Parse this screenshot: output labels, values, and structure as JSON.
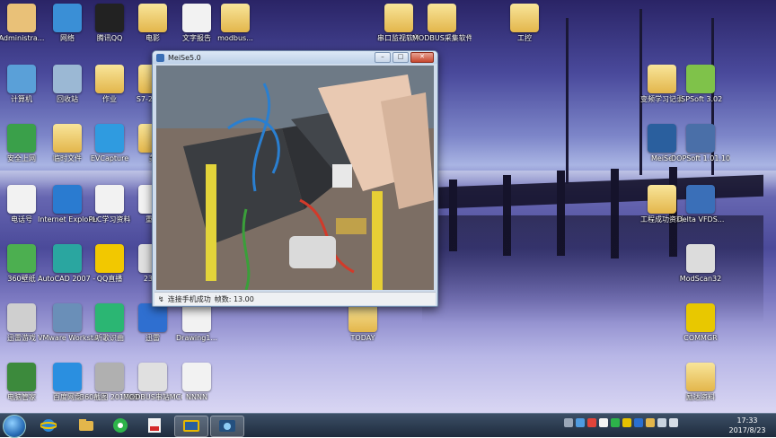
{
  "desktop": {
    "icons": [
      {
        "label": "Administra...",
        "kind": "user",
        "color": "#e9c178"
      },
      {
        "label": "网络",
        "kind": "globe",
        "color": "#3a8fd6"
      },
      {
        "label": "腾讯QQ",
        "kind": "qq",
        "color": "#222222"
      },
      {
        "label": "电影",
        "kind": "folder",
        "color": "#e6c15a"
      },
      {
        "label": "文字报告",
        "kind": "doc",
        "color": "#f2f2f2"
      },
      {
        "label": "modbus...",
        "kind": "folder",
        "color": "#e6c15a"
      },
      {
        "label": "串口监视软件",
        "kind": "folder",
        "color": "#e6c15a"
      },
      {
        "label": "MODBUS采集软件",
        "kind": "folder",
        "color": "#e6c15a"
      },
      {
        "label": "工控",
        "kind": "folder",
        "color": "#e6c15a"
      },
      {
        "label": "计算机",
        "kind": "computer",
        "color": "#5aa0d8"
      },
      {
        "label": "回收站",
        "kind": "bin",
        "color": "#9bb8d4"
      },
      {
        "label": "作业",
        "kind": "folder",
        "color": "#e6c15a"
      },
      {
        "label": "S7-200软",
        "kind": "folder",
        "color": "#e6c15a"
      },
      {
        "label": "安全上网",
        "kind": "ie",
        "color": "#3aa04a"
      },
      {
        "label": "临时文件",
        "kind": "folder",
        "color": "#e6c15a"
      },
      {
        "label": "EVCapture",
        "kind": "ev",
        "color": "#2f9be0"
      },
      {
        "label": "美",
        "kind": "folder",
        "color": "#e6c15a"
      },
      {
        "label": "电话号",
        "kind": "doc",
        "color": "#f2f2f2"
      },
      {
        "label": "Internet Explorer",
        "kind": "ie",
        "color": "#2a7bd0"
      },
      {
        "label": "PLC学习资料",
        "kind": "doc",
        "color": "#f2f2f2"
      },
      {
        "label": "重庆",
        "kind": "doc",
        "color": "#f2f2f2"
      },
      {
        "label": "360壁纸",
        "kind": "app",
        "color": "#4caf50"
      },
      {
        "label": "AutoCAD 2007 - S...",
        "kind": "app",
        "color": "#2aa6a0"
      },
      {
        "label": "QQ直播",
        "kind": "app",
        "color": "#f2c800"
      },
      {
        "label": "2345",
        "kind": "app",
        "color": "#e0e0e0"
      },
      {
        "label": "迅雷游戏",
        "kind": "app",
        "color": "#cfcfcf"
      },
      {
        "label": "VMware Workstation",
        "kind": "app",
        "color": "#6a8fb8"
      },
      {
        "label": "听歌识曲",
        "kind": "app",
        "color": "#2bb673"
      },
      {
        "label": "迅雷",
        "kind": "app",
        "color": "#2f6fd0"
      },
      {
        "label": "Drawing1...",
        "kind": "doc",
        "color": "#f2f2f2"
      },
      {
        "label": "TODAY",
        "kind": "folder",
        "color": "#e6c15a"
      },
      {
        "label": "电脑管家",
        "kind": "app",
        "color": "#3c8a3c"
      },
      {
        "label": "百度网盘",
        "kind": "app",
        "color": "#2a8fe0"
      },
      {
        "label": "360截图 20170804...",
        "kind": "img",
        "color": "#b0b0b0"
      },
      {
        "label": "MODBUS串站MCGS",
        "kind": "app",
        "color": "#e0e0e0"
      },
      {
        "label": "NNNN",
        "kind": "doc",
        "color": "#f2f2f2"
      },
      {
        "label": "变频学习记录",
        "kind": "folder",
        "color": "#e6c15a"
      },
      {
        "label": "ISPSoft 3.02",
        "kind": "app",
        "color": "#7fc24a"
      },
      {
        "label": "MeiSe",
        "kind": "app",
        "color": "#2a5f9e"
      },
      {
        "label": "DOPSoft 1.01.10",
        "kind": "app",
        "color": "#4a6fa8"
      },
      {
        "label": "工程成功资料",
        "kind": "folder",
        "color": "#e6c15a"
      },
      {
        "label": "Delta VFDS...",
        "kind": "app",
        "color": "#3a6fb8"
      },
      {
        "label": "ModScan32",
        "kind": "app",
        "color": "#dcdcdc"
      },
      {
        "label": "COMMGR",
        "kind": "app",
        "color": "#e8c800"
      },
      {
        "label": "励达资料",
        "kind": "folder",
        "color": "#e6c15a"
      }
    ]
  },
  "window": {
    "title": "MeiSe5.0",
    "min_label": "–",
    "max_label": "□",
    "close_label": "✕",
    "status": "连接手机成功",
    "fps": "帧数: 13.00"
  },
  "taskbar": {
    "items": [
      "start",
      "ie",
      "explorer",
      "360",
      "pdf",
      "tv-window",
      "meise"
    ],
    "time": "17:33",
    "date": "2017/8/23"
  }
}
